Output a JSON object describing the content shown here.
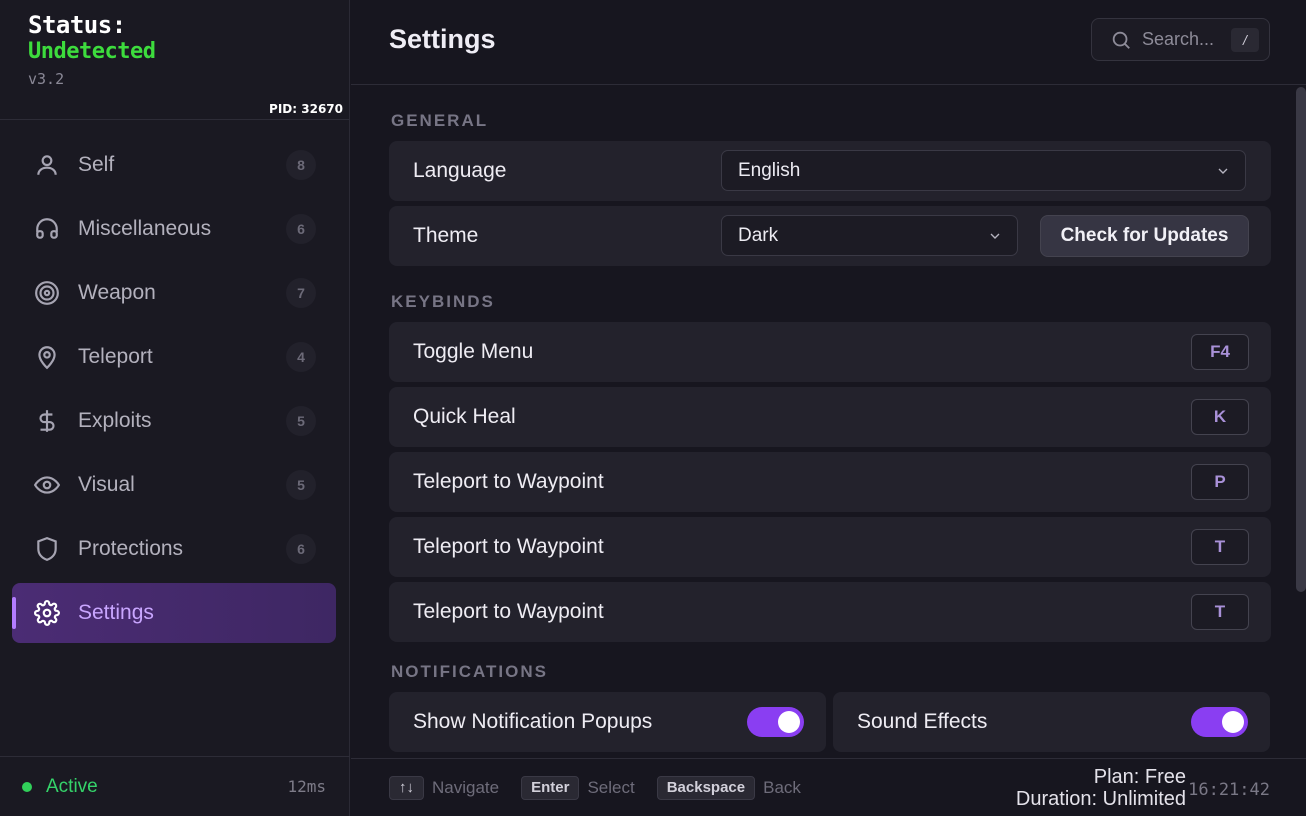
{
  "status": {
    "title": "Status:",
    "value": "Undetected",
    "version": "v3.2",
    "pid": "PID: 32670"
  },
  "sidebar": {
    "items": [
      {
        "label": "Self",
        "count": "8",
        "icon": "user-icon"
      },
      {
        "label": "Miscellaneous",
        "count": "6",
        "icon": "headset-icon"
      },
      {
        "label": "Weapon",
        "count": "7",
        "icon": "target-icon"
      },
      {
        "label": "Teleport",
        "count": "4",
        "icon": "location-pin-icon"
      },
      {
        "label": "Exploits",
        "count": "5",
        "icon": "dollar-icon"
      },
      {
        "label": "Visual",
        "count": "5",
        "icon": "eye-icon"
      },
      {
        "label": "Protections",
        "count": "6",
        "icon": "shield-icon"
      },
      {
        "label": "Settings",
        "count": "",
        "icon": "gear-icon"
      }
    ],
    "active_item": "Settings",
    "footer": {
      "status": "Active",
      "latency": "12ms"
    }
  },
  "header": {
    "title": "Settings",
    "search_placeholder": "Search...",
    "search_shortcut": "/"
  },
  "general": {
    "label": "GENERAL",
    "language_label": "Language",
    "language_value": "English",
    "theme_label": "Theme",
    "theme_value": "Dark",
    "updates_button": "Check for Updates"
  },
  "keybinds": {
    "label": "KEYBINDS",
    "rows": [
      {
        "label": "Toggle Menu",
        "key": "F4"
      },
      {
        "label": "Quick Heal",
        "key": "K"
      },
      {
        "label": "Teleport to Waypoint",
        "key": "P"
      },
      {
        "label": "Teleport to Waypoint",
        "key": "T"
      },
      {
        "label": "Teleport to Waypoint",
        "key": "T"
      }
    ]
  },
  "notifications": {
    "label": "NOTIFICATIONS",
    "popups_label": "Show Notification Popups",
    "popups_on": true,
    "sound_label": "Sound Effects",
    "sound_on": true
  },
  "footer": {
    "hints": [
      {
        "key": "↑↓",
        "label": "Navigate"
      },
      {
        "key": "Enter",
        "label": "Select"
      },
      {
        "key": "Backspace",
        "label": "Back"
      }
    ],
    "plan": "Plan: Free",
    "duration": "Duration: Unlimited",
    "time": "16:21:42"
  },
  "colors": {
    "accent": "#8a3ef2",
    "status_green": "#3ddc3d",
    "background": "#17161f"
  }
}
